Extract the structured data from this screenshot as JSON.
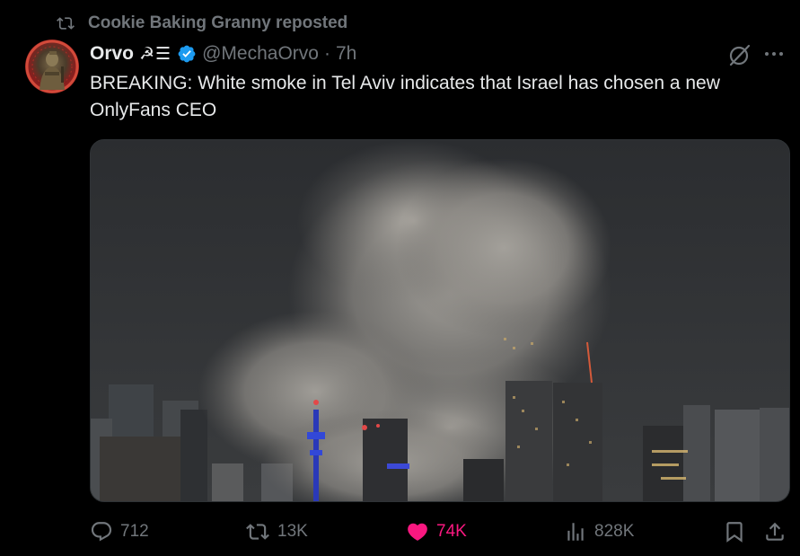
{
  "social_context": {
    "icon": "repost-icon",
    "text": "Cookie Baking Granny reposted"
  },
  "author": {
    "display_name": "Orvo",
    "name_emoji": "☭☰",
    "verified": true,
    "handle": "@MechaOrvo",
    "separator": "·",
    "time": "7h"
  },
  "post": {
    "text": "BREAKING: White smoke in Tel Aviv indicates that Israel has chosen a new OnlyFans CEO"
  },
  "actions": {
    "replies": "712",
    "reposts": "13K",
    "likes": "74K",
    "views": "828K"
  },
  "colors": {
    "background": "#000000",
    "text": "#e7e9ea",
    "muted": "#71767b",
    "verified": "#1d9bf0",
    "like": "#f91880"
  }
}
